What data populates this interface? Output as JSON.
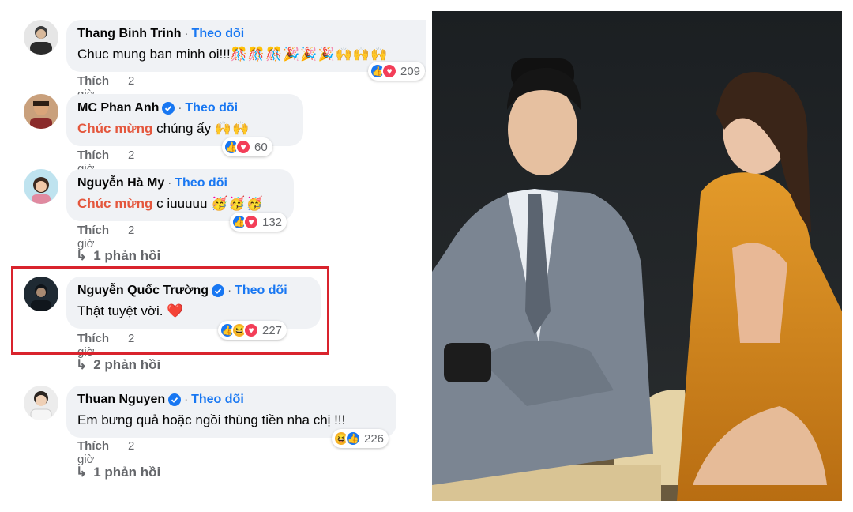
{
  "comments": [
    {
      "name": "Thang Binh Trinh",
      "verified": false,
      "follow": "Theo dõi",
      "prefix": "",
      "text": "Chuc mung ban minh oi!!!",
      "emoji": "🎊🎊🎊🎉🎉🎉🙌🙌🙌",
      "react_count": "209",
      "like": "Thích",
      "time": "2 giờ",
      "replies": ""
    },
    {
      "name": "MC Phan Anh",
      "verified": true,
      "follow": "Theo dõi",
      "prefix": "Chúc mừng",
      "text": " chúng ấy ",
      "emoji": "🙌🙌",
      "react_count": "60",
      "like": "Thích",
      "time": "2 giờ",
      "replies": ""
    },
    {
      "name": "Nguyễn Hà My",
      "verified": false,
      "follow": "Theo dõi",
      "prefix": "Chúc mừng",
      "text": " c iuuuuu ",
      "emoji": "🥳🥳🥳",
      "react_count": "132",
      "like": "Thích",
      "time": "2 giờ",
      "replies": "1 phản hồi"
    },
    {
      "name": "Nguyễn Quốc Trường",
      "verified": true,
      "follow": "Theo dõi",
      "prefix": "",
      "text": "Thật tuyệt vời. ",
      "emoji": "❤️",
      "react_count": "227",
      "like": "Thích",
      "time": "2 giờ",
      "replies": "2 phản hồi"
    },
    {
      "name": "Thuan Nguyen",
      "verified": true,
      "follow": "Theo dõi",
      "prefix": "",
      "text": "Em bưng quả hoặc ngồi thùng tiền nha chị !!!",
      "emoji": "",
      "react_count": "226",
      "like": "Thích",
      "time": "2 giờ",
      "replies": "1 phản hồi"
    }
  ],
  "colors": {
    "follow": "#1877f2",
    "highlight": "#d9232d",
    "chuc_mung": "#e4573d"
  },
  "icons": {
    "verified": "verified-badge-icon",
    "reply": "reply-arrow-icon",
    "like": "like-reaction-icon",
    "love": "love-reaction-icon",
    "haha": "haha-reaction-icon"
  }
}
